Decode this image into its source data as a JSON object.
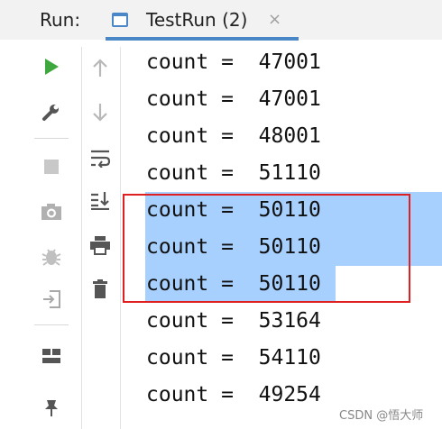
{
  "header": {
    "run_label": "Run:",
    "tab_title": "TestRun (2)",
    "tab_close": "×"
  },
  "toolbar_left": {
    "items": [
      {
        "name": "run-icon"
      },
      {
        "name": "wrench-icon"
      },
      {
        "name": "stop-icon"
      },
      {
        "name": "camera-icon"
      },
      {
        "name": "debug-bug-icon"
      },
      {
        "name": "login-icon"
      },
      {
        "name": "layout-icon"
      },
      {
        "name": "pin-icon"
      }
    ]
  },
  "toolbar_right": {
    "items": [
      {
        "name": "arrow-up-icon"
      },
      {
        "name": "arrow-down-icon"
      },
      {
        "name": "soft-wrap-icon"
      },
      {
        "name": "scroll-to-end-icon"
      },
      {
        "name": "print-icon"
      },
      {
        "name": "trash-icon"
      }
    ]
  },
  "console": {
    "lines": [
      "count =  47001",
      "count =  47001",
      "count =  48001",
      "count =  51110",
      "count =  50110",
      "count =  50110",
      "count =  50110",
      "count =  53164",
      "count =  54110",
      "count =  49254"
    ],
    "selected_lines": [
      4,
      5,
      6
    ]
  },
  "colors": {
    "selection": "#a7d0ff",
    "highlight_box": "#e02020",
    "accent": "#4a87c7",
    "run_green": "#3ea83e"
  },
  "watermark": "CSDN @悟大师"
}
